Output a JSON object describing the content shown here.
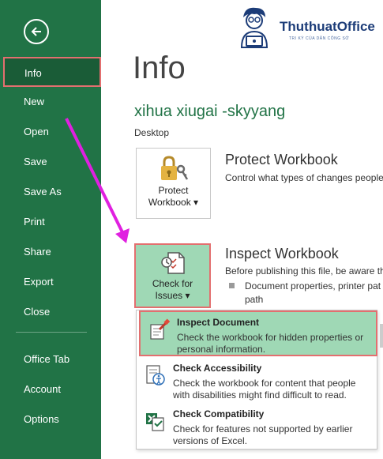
{
  "sidebar": {
    "items": [
      {
        "label": "Info"
      },
      {
        "label": "New"
      },
      {
        "label": "Open"
      },
      {
        "label": "Save"
      },
      {
        "label": "Save As"
      },
      {
        "label": "Print"
      },
      {
        "label": "Share"
      },
      {
        "label": "Export"
      },
      {
        "label": "Close"
      },
      {
        "label": "Office Tab"
      },
      {
        "label": "Account"
      },
      {
        "label": "Options"
      }
    ]
  },
  "logo": {
    "name": "ThuthuatOffice",
    "tagline": "TRI KỲ CỦA DÂN CÔNG SỞ"
  },
  "main": {
    "title": "Info",
    "file_name": "xihua xiugai -skyyang",
    "file_location": "Desktop",
    "protect": {
      "button_line1": "Protect",
      "button_line2": "Workbook ▾",
      "title": "Protect Workbook",
      "desc": "Control what types of changes people"
    },
    "inspect": {
      "button_line1": "Check for",
      "button_line2": "Issues ▾",
      "title": "Inspect Workbook",
      "desc": "Before publishing this file, be aware th",
      "bullet_line1": "Document properties, printer pat",
      "bullet_line2": "path"
    }
  },
  "dropdown": {
    "items": [
      {
        "title": "Inspect Document",
        "desc": "Check the workbook for hidden properties or personal information."
      },
      {
        "title": "Check Accessibility",
        "desc": "Check the workbook for content that people with disabilities might find difficult to read."
      },
      {
        "title": "Check Compatibility",
        "desc": "Check for features not supported by earlier versions of Excel."
      }
    ]
  },
  "colors": {
    "sidebar_bg": "#217346",
    "highlight_border": "#e36f6f",
    "annotation_arrow": "#e020e0",
    "highlight_bg": "#9fd8b5"
  }
}
